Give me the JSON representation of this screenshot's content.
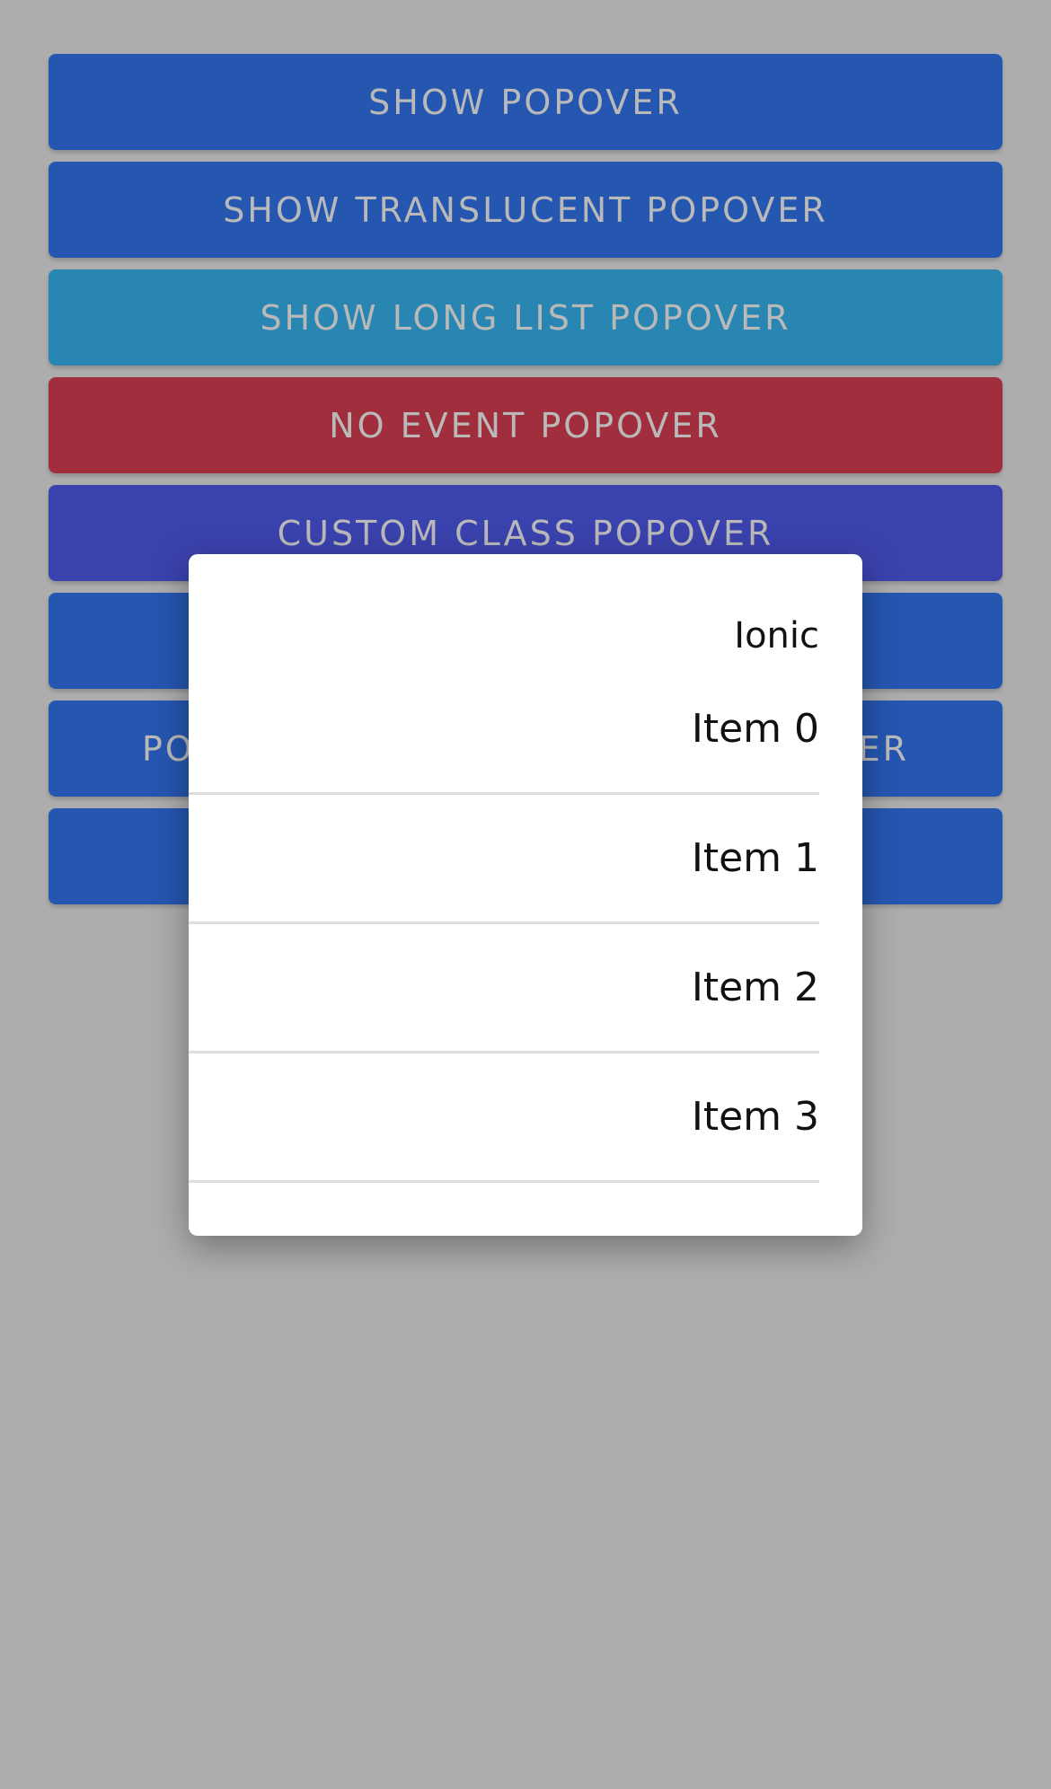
{
  "buttons": [
    {
      "label": "SHOW POPOVER",
      "color": "#2556b0"
    },
    {
      "label": "SHOW TRANSLUCENT POPOVER",
      "color": "#2556b0"
    },
    {
      "label": "SHOW LONG LIST POPOVER",
      "color": "#2985b1"
    },
    {
      "label": "NO EVENT POPOVER",
      "color": "#a12e3c"
    },
    {
      "label": "CUSTOM CLASS POPOVER",
      "color": "#3a42ad"
    },
    {
      "label": "",
      "color": "#2556b0"
    },
    {
      "label": "PO",
      "label_right": "ER",
      "color": "#2556b0"
    },
    {
      "label": "",
      "color": "#2556b0"
    }
  ],
  "popover": {
    "header": "Ionic",
    "items": [
      "Item 0",
      "Item 1",
      "Item 2",
      "Item 3"
    ]
  },
  "colors": {
    "backdrop": "#adadad",
    "popover_bg": "#ffffff",
    "divider": "#dddddd"
  }
}
